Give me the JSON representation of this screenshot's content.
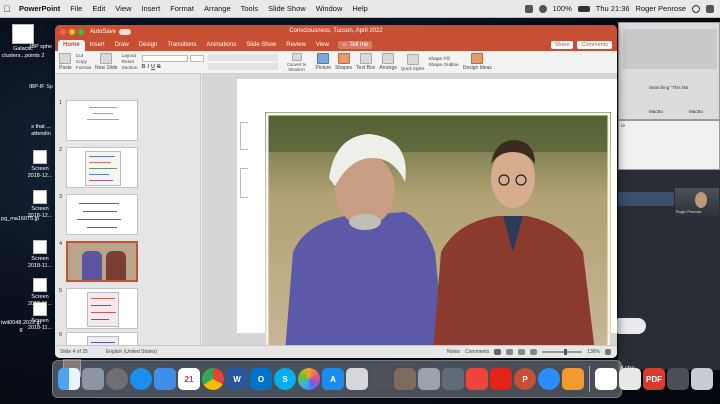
{
  "menubar": {
    "app": "PowerPoint",
    "items": [
      "File",
      "Edit",
      "View",
      "Insert",
      "Format",
      "Arrange",
      "Tools",
      "Slide Show",
      "Window",
      "Help"
    ],
    "battery": "100%",
    "clock": "Thu 21:36",
    "user": "Roger Penrose"
  },
  "desktop_left": [
    {
      "label": "Galactic clusters...points 2",
      "style": "pdf"
    },
    {
      "label": "IBP sphe",
      "style": "dark"
    },
    {
      "label": "IBP-IF Sp",
      "style": "dark"
    },
    {
      "label": "s that ... attendin",
      "style": "dark"
    },
    {
      "label": "Screen 2018-12...",
      "style": "pdf"
    },
    {
      "label": "Screen 2018-12...",
      "style": "pdf"
    },
    {
      "label": "pg_ma16075.jp",
      "style": "photo"
    },
    {
      "label": "Screen 2018-11...",
      "style": "pdf"
    },
    {
      "label": "Screen 2018-11...",
      "style": "pdf"
    },
    {
      "label": "Screen 2018-11...",
      "style": "pdf"
    },
    {
      "label": "twit0048.2022.jp g",
      "style": "photo"
    }
  ],
  "window": {
    "autosave": "AutoSave",
    "title": "Consciousness, Tucson, April 2022",
    "tabs": [
      "Home",
      "Insert",
      "Draw",
      "Design",
      "Transitions",
      "Animations",
      "Slide Show",
      "Review",
      "View"
    ],
    "active_tab": "Home",
    "tell_me": "Tell me",
    "share": "Share",
    "comments": "Comments"
  },
  "ribbon": {
    "paste": "Paste",
    "cut": "Cut",
    "copy": "Copy",
    "format": "Format",
    "new_slide": "New Slide",
    "layout": "Layout",
    "reset": "Reset",
    "section": "Section",
    "convert": "Convert to SmartArt",
    "picture": "Picture",
    "shapes": "Shapes",
    "textbox": "Text Box",
    "arrange": "Arrange",
    "quick_styles": "Quick Styles",
    "shape_fill": "Shape Fill",
    "shape_outline": "Shape Outline",
    "design_ideas": "Design Ideas"
  },
  "slides": [
    "1",
    "2",
    "3",
    "4",
    "5",
    "6"
  ],
  "selected_slide": 4,
  "status": {
    "slide_of": "Slide 4 of 25",
    "language": "English (United States)",
    "notes": "Notes",
    "comments": "Comments",
    "zoom": "136%"
  },
  "right_side": {
    "searching": "Searching \"This Ma",
    "macbook1": "MacBo",
    "macbook2": "MacBo",
    "user_label": "Roger Penrose",
    "msg": "d sho...",
    "tag1": "re"
  },
  "colors": {
    "ppt_accent": "#c74f34",
    "menubar": "#e9e9ea"
  }
}
